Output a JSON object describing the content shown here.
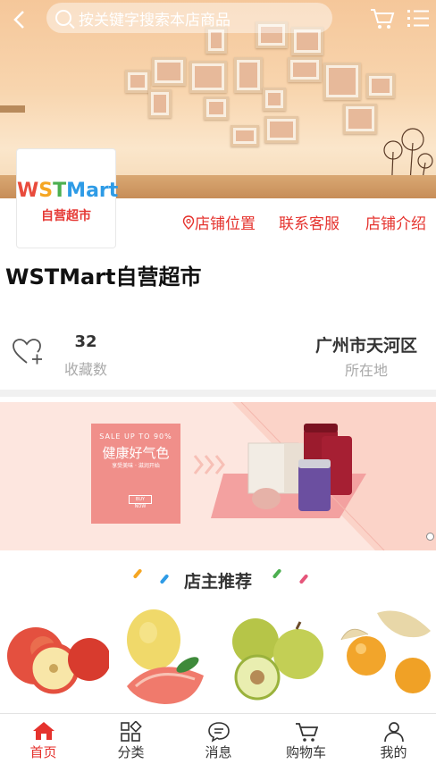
{
  "header": {
    "back_icon": "chevron-left-icon",
    "search_placeholder": "按关键字搜索本店商品",
    "cart_icon": "cart-icon",
    "menu_icon": "list-menu-icon"
  },
  "store": {
    "logo_text": "WSTMart",
    "logo_subtext": "自营超市",
    "name": "WSTMart自营超市",
    "links": [
      "店铺位置",
      "联系客服",
      "店铺介绍"
    ],
    "favorites_count": "32",
    "favorites_label": "收藏数",
    "location_value": "广州市天河区",
    "location_label": "所在地"
  },
  "promo": {
    "sale_text": "SALE UP TO 90%",
    "title": "健康好气色",
    "subtitle": "享受美味 · 滋润开始",
    "button": "BUY NOW"
  },
  "recommend": {
    "title": "店主推荐",
    "products": [
      "apple",
      "pomelo",
      "pear",
      "physalis"
    ]
  },
  "tabbar": {
    "items": [
      {
        "label": "首页",
        "icon": "home-icon",
        "active": true
      },
      {
        "label": "分类",
        "icon": "category-icon",
        "active": false
      },
      {
        "label": "消息",
        "icon": "message-icon",
        "active": false
      },
      {
        "label": "购物车",
        "icon": "cart-icon",
        "active": false
      },
      {
        "label": "我的",
        "icon": "user-icon",
        "active": false
      }
    ]
  },
  "colors": {
    "accent": "#e5322d",
    "logo_w": "#e94b3c",
    "logo_s": "#f5a623",
    "logo_t": "#4caf50",
    "logo_mart": "#2e9be6"
  }
}
